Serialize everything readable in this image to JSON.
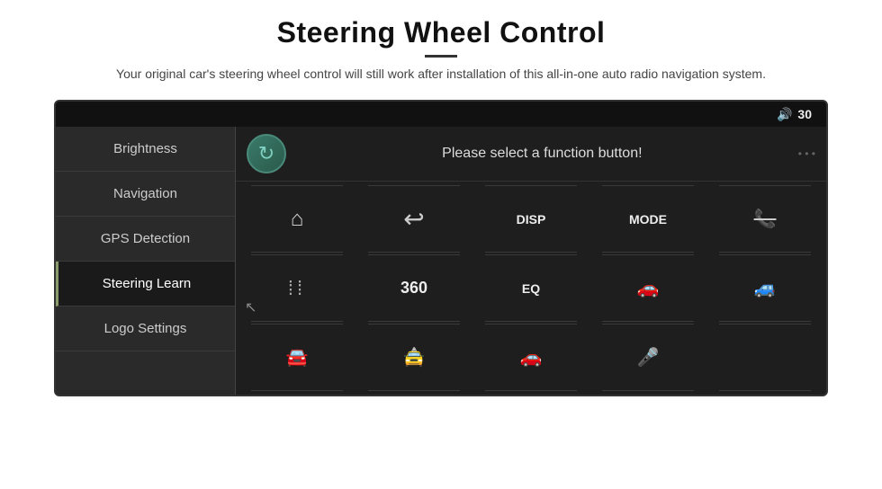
{
  "header": {
    "title": "Steering Wheel Control",
    "subtitle": "Your original car's steering wheel control will still work after installation of this all-in-one auto radio navigation system."
  },
  "statusBar": {
    "volume": "30"
  },
  "sidebar": {
    "items": [
      {
        "id": "brightness",
        "label": "Brightness",
        "active": false
      },
      {
        "id": "navigation",
        "label": "Navigation",
        "active": false
      },
      {
        "id": "gps",
        "label": "GPS Detection",
        "active": false
      },
      {
        "id": "steering",
        "label": "Steering Learn",
        "active": true
      },
      {
        "id": "logo",
        "label": "Logo Settings",
        "active": false
      }
    ]
  },
  "panel": {
    "message": "Please select a function button!",
    "refreshIcon": "↻",
    "buttons": [
      {
        "id": "home",
        "icon": "🏠",
        "type": "icon"
      },
      {
        "id": "back",
        "icon": "↩",
        "type": "icon"
      },
      {
        "id": "disp",
        "label": "DISP",
        "type": "label"
      },
      {
        "id": "mode",
        "label": "MODE",
        "type": "label"
      },
      {
        "id": "phone-off",
        "icon": "📵",
        "type": "icon"
      },
      {
        "id": "equalizer",
        "icon": "⚙",
        "type": "icon-eq"
      },
      {
        "id": "three-sixty",
        "label": "360",
        "type": "label"
      },
      {
        "id": "eq",
        "label": "EQ",
        "type": "label"
      },
      {
        "id": "car1",
        "icon": "🚗",
        "type": "icon"
      },
      {
        "id": "car2",
        "icon": "🚙",
        "type": "icon"
      },
      {
        "id": "car3",
        "icon": "🚘",
        "type": "icon"
      },
      {
        "id": "car4",
        "icon": "🚖",
        "type": "icon"
      },
      {
        "id": "car5",
        "icon": "🎤",
        "type": "icon"
      }
    ]
  }
}
